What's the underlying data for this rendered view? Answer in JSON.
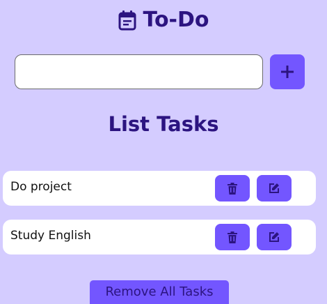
{
  "header": {
    "title": "To-Do",
    "icon": "calendar-icon"
  },
  "input": {
    "value": "",
    "placeholder": ""
  },
  "add_button": {
    "icon": "plus-icon"
  },
  "list": {
    "title": "List Tasks",
    "tasks": [
      {
        "text": "Do project"
      },
      {
        "text": "Study English"
      }
    ]
  },
  "remove_all_label": "Remove All Tasks",
  "colors": {
    "background": "#d4ccff",
    "accent": "#7356ff",
    "heading": "#2c1480",
    "card": "#ffffff"
  }
}
